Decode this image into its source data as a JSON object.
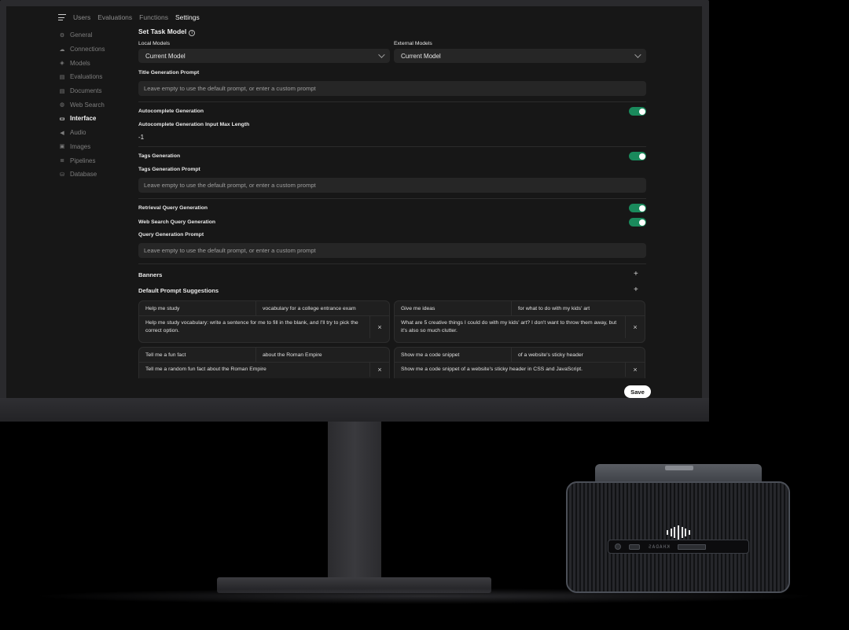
{
  "nav": {
    "tabs": [
      "Users",
      "Evaluations",
      "Functions",
      "Settings"
    ],
    "active": "Settings"
  },
  "sidebar": {
    "items": [
      {
        "label": "General",
        "icon": "gear-icon"
      },
      {
        "label": "Connections",
        "icon": "cloud-icon"
      },
      {
        "label": "Models",
        "icon": "cube-icon"
      },
      {
        "label": "Evaluations",
        "icon": "document-icon"
      },
      {
        "label": "Documents",
        "icon": "document-icon"
      },
      {
        "label": "Web Search",
        "icon": "globe-icon"
      },
      {
        "label": "Interface",
        "icon": "monitor-icon"
      },
      {
        "label": "Audio",
        "icon": "speaker-icon"
      },
      {
        "label": "Images",
        "icon": "image-icon"
      },
      {
        "label": "Pipelines",
        "icon": "layers-icon"
      },
      {
        "label": "Database",
        "icon": "database-icon"
      }
    ],
    "active": "Interface"
  },
  "task_model": {
    "heading": "Set Task Model",
    "local_label": "Local Models",
    "local_value": "Current Model",
    "external_label": "External Models",
    "external_value": "Current Model"
  },
  "title_generation": {
    "label": "Title Generation Prompt",
    "placeholder": "Leave empty to use the default prompt, or enter a custom prompt"
  },
  "autocomplete": {
    "label": "Autocomplete Generation",
    "enabled": true,
    "max_length_label": "Autocomplete Generation Input Max Length",
    "max_length_value": "-1"
  },
  "tags": {
    "label": "Tags Generation",
    "enabled": true,
    "prompt_label": "Tags Generation Prompt",
    "placeholder": "Leave empty to use the default prompt, or enter a custom prompt"
  },
  "retrieval_query": {
    "label": "Retrieval Query Generation",
    "enabled": true
  },
  "web_search_query": {
    "label": "Web Search Query Generation",
    "enabled": true
  },
  "query_prompt": {
    "label": "Query Generation Prompt",
    "placeholder": "Leave empty to use the default prompt, or enter a custom prompt"
  },
  "banners": {
    "label": "Banners",
    "add": "+"
  },
  "suggestions": {
    "label": "Default Prompt Suggestions",
    "add": "+",
    "items": [
      {
        "title": "Help me study",
        "subtitle": "vocabulary for a college entrance exam",
        "content": "Help me study vocabulary: write a sentence for me to fill in the blank, and I'll try to pick the correct option."
      },
      {
        "title": "Give me ideas",
        "subtitle": "for what to do with my kids' art",
        "content": "What are 5 creative things I could do with my kids' art? I don't want to throw them away, but it's also so much clutter."
      },
      {
        "title": "Tell me a fun fact",
        "subtitle": "about the Roman Empire",
        "content": "Tell me a random fun fact about the Roman Empire"
      },
      {
        "title": "Show me a code snippet",
        "subtitle": "of a website's sticky header",
        "content": "Show me a code snippet of a website's sticky header in CSS and JavaScript."
      }
    ],
    "remove": "×"
  },
  "save_label": "Save",
  "device": {
    "brand": "KHADAS"
  },
  "colors": {
    "toggle_on": "#1a8a5c",
    "background": "#171717",
    "input": "#262626"
  }
}
